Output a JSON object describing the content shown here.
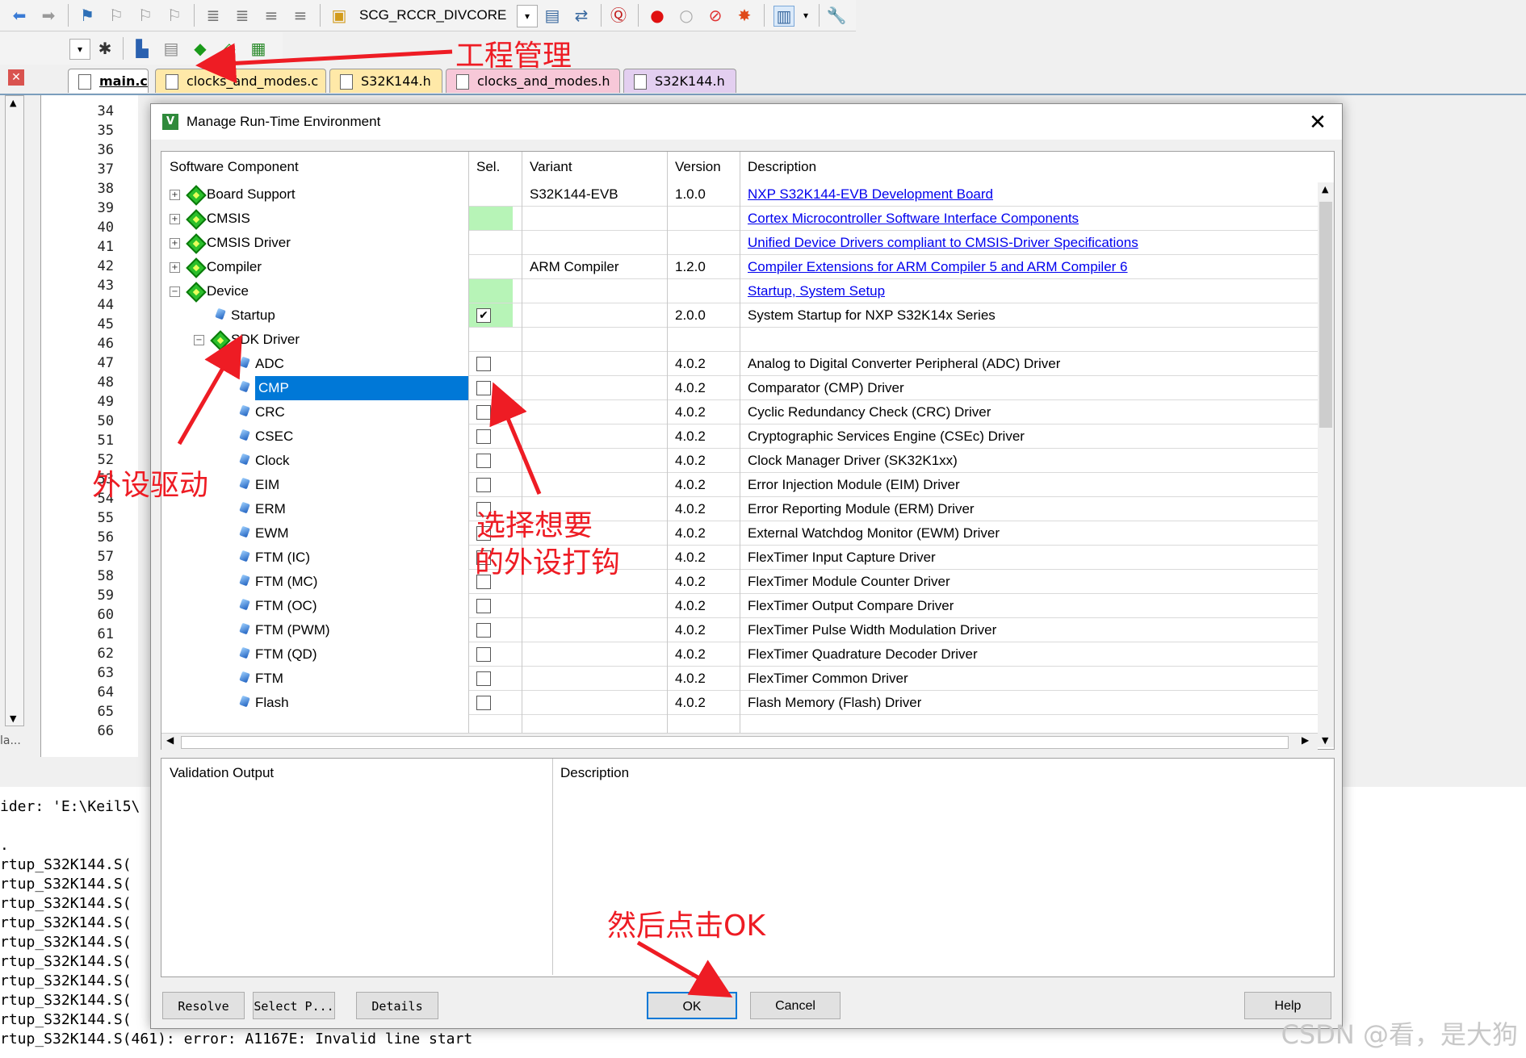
{
  "toolbar": {
    "target_name": "SCG_RCCR_DIVCORE",
    "icons": [
      "back-icon",
      "forward-icon",
      "bookmark-icon",
      "bookmark-prev-icon",
      "bookmark-next-icon",
      "bookmark-clear-icon",
      "indent-icon",
      "unindent-icon",
      "comment-icon",
      "uncomment-icon",
      "find-in-files-icon",
      "dropdown-icon",
      "options-icon",
      "translate-icon",
      "debug-icon",
      "breakpoint-icon",
      "breakpoint-disable-icon",
      "breakpoint-kill-icon",
      "breakpoint-all-icon",
      "window-icon",
      "tools-icon"
    ],
    "row2_icons": [
      "build-icon",
      "rebuild-icon",
      "load-icon",
      "manage-rte-icon",
      "select-packs-icon",
      "pack-installer-icon"
    ]
  },
  "tabs": [
    {
      "label": "main.c",
      "active": true
    },
    {
      "label": "clocks_and_modes.c"
    },
    {
      "label": "S32K144.h"
    },
    {
      "label": "clocks_and_modes.h"
    },
    {
      "label": "S32K144.h"
    }
  ],
  "line_numbers": [
    "34",
    "35",
    "36",
    "37",
    "38",
    "39",
    "40",
    "41",
    "42",
    "43",
    "44",
    "45",
    "46",
    "47",
    "48",
    "49",
    "50",
    "51",
    "52",
    "53",
    "54",
    "55",
    "56",
    "57",
    "58",
    "59",
    "60",
    "61",
    "62",
    "63",
    "64",
    "65",
    "66"
  ],
  "dialog": {
    "title": "Manage Run-Time Environment",
    "columns": {
      "component": "Software Component",
      "sel": "Sel.",
      "variant": "Variant",
      "version": "Version",
      "description": "Description"
    },
    "rows": [
      {
        "name": "Board Support",
        "variant": "S32K144-EVB",
        "version": "1.0.0",
        "desc": "NXP S32K144-EVB Development Board",
        "link": true
      },
      {
        "name": "CMSIS",
        "variant": "",
        "version": "",
        "desc": "Cortex Microcontroller Software Interface Components",
        "link": true
      },
      {
        "name": "CMSIS Driver",
        "variant": "",
        "version": "",
        "desc": "Unified Device Drivers compliant to CMSIS-Driver Specifications",
        "link": true
      },
      {
        "name": "Compiler",
        "variant": "ARM Compiler",
        "version": "1.2.0",
        "desc": "Compiler Extensions for ARM Compiler 5 and ARM Compiler 6",
        "link": true
      },
      {
        "name": "Device",
        "variant": "",
        "version": "",
        "desc": "Startup, System Setup",
        "link": true
      },
      {
        "name": "Startup",
        "variant": "",
        "version": "2.0.0",
        "desc": "System Startup for NXP S32K14x Series",
        "checked": true
      },
      {
        "name": "SDK Driver",
        "variant": "",
        "version": "",
        "desc": ""
      },
      {
        "name": "ADC",
        "version": "4.0.2",
        "desc": "Analog to Digital Converter Peripheral (ADC) Driver"
      },
      {
        "name": "CMP",
        "version": "4.0.2",
        "desc": "Comparator (CMP) Driver",
        "selected": true
      },
      {
        "name": "CRC",
        "version": "4.0.2",
        "desc": "Cyclic Redundancy Check (CRC) Driver"
      },
      {
        "name": "CSEC",
        "version": "4.0.2",
        "desc": "Cryptographic Services Engine (CSEc) Driver"
      },
      {
        "name": "Clock",
        "version": "4.0.2",
        "desc": "Clock Manager Driver (SK32K1xx)"
      },
      {
        "name": "EIM",
        "version": "4.0.2",
        "desc": "Error Injection Module (EIM) Driver"
      },
      {
        "name": "ERM",
        "version": "4.0.2",
        "desc": "Error Reporting Module (ERM) Driver"
      },
      {
        "name": "EWM",
        "version": "4.0.2",
        "desc": "External Watchdog Monitor (EWM) Driver"
      },
      {
        "name": "FTM (IC)",
        "version": "4.0.2",
        "desc": "FlexTimer Input Capture Driver"
      },
      {
        "name": "FTM (MC)",
        "version": "4.0.2",
        "desc": "FlexTimer Module Counter Driver"
      },
      {
        "name": "FTM (OC)",
        "version": "4.0.2",
        "desc": "FlexTimer Output Compare Driver"
      },
      {
        "name": "FTM (PWM)",
        "version": "4.0.2",
        "desc": "FlexTimer Pulse Width Modulation Driver"
      },
      {
        "name": "FTM (QD)",
        "version": "4.0.2",
        "desc": "FlexTimer Quadrature Decoder Driver"
      },
      {
        "name": "FTM",
        "version": "4.0.2",
        "desc": "FlexTimer Common Driver"
      },
      {
        "name": "Flash",
        "version": "4.0.2",
        "desc": "Flash Memory (Flash) Driver"
      }
    ],
    "validation_header": "Validation Output",
    "validation_desc_header": "Description",
    "buttons": {
      "resolve": "Resolve",
      "select_packs": "Select P...",
      "details": "Details",
      "ok": "OK",
      "cancel": "Cancel",
      "help": "Help"
    }
  },
  "output_lines": [
    "ider: 'E:\\Keil5\\",
    "",
    ".",
    "rtup_S32K144.S(",
    "rtup_S32K144.S(",
    "rtup_S32K144.S(",
    "rtup_S32K144.S(",
    "rtup_S32K144.S(",
    "rtup_S32K144.S(",
    "rtup_S32K144.S(",
    "rtup_S32K144.S(",
    "rtup_S32K144.S(",
    "rtup_S32K144.S(461): error: A1167E: Invalid line start"
  ],
  "left_pane_label": "la...",
  "annotations": {
    "project_manage": "工程管理",
    "peripheral_driver": "外设驱动",
    "select_line1": "选择想要",
    "select_line2": "的外设打钩",
    "then_ok": "然后点击OK"
  },
  "watermark": "CSDN @看，是大狗"
}
